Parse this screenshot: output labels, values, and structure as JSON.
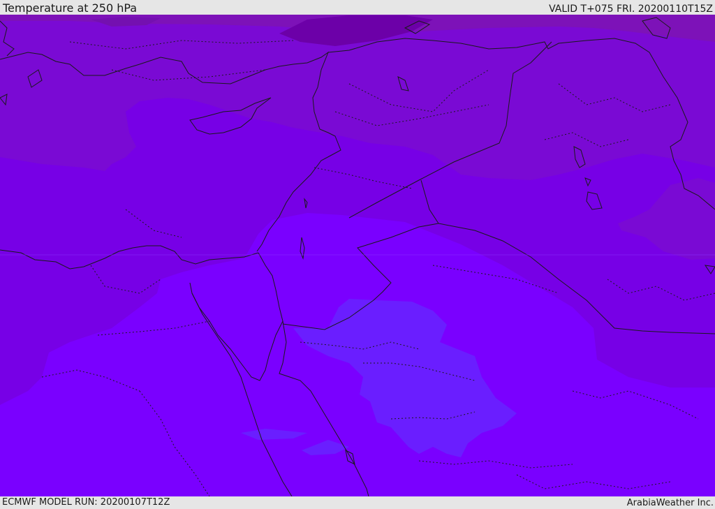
{
  "header": {
    "title": "Temperature at 250 hPa",
    "valid": "VALID T+075 FRI. 20200110T15Z"
  },
  "footer": {
    "model_run": "ECMWF MODEL RUN: 20200107T12Z",
    "brand": "ArabiaWeather Inc."
  },
  "map": {
    "colors": {
      "warmest": "#7d12b8",
      "warm": "#7a0ad4",
      "mid": "#7700e6",
      "cool": "#7a00ff",
      "coolest": "#6a1eff",
      "dark_patch": "#6c00a8",
      "outline": "#1a1a1a"
    }
  }
}
